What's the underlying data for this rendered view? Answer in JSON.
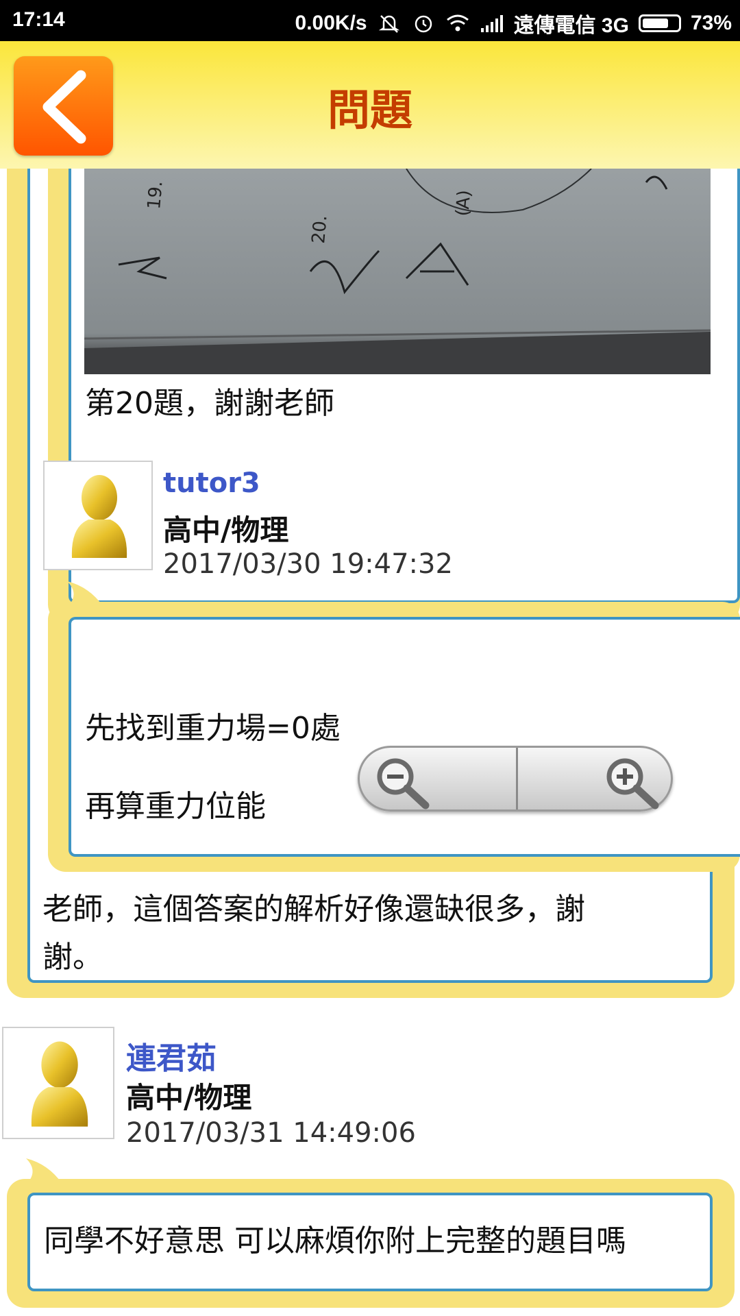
{
  "status_bar": {
    "time": "17:14",
    "speed": "0.00K/s",
    "carrier": "遠傳電信 3G",
    "battery": "73%",
    "battery_level": 0.73,
    "icons": [
      "mute-icon",
      "alarm-icon",
      "wifi-icon",
      "signal-icon",
      "battery-icon"
    ]
  },
  "header": {
    "title": "問題",
    "back_icon": "chevron-left-icon"
  },
  "messages": [
    {
      "caption": "第20題，謝謝老師",
      "photo_description_text": [
        "19.",
        "20.",
        "(A)"
      ]
    },
    {
      "author": "tutor3",
      "subject": "高中/物理",
      "timestamp": "2017/03/30 19:47:32",
      "lines": [
        "先找到重力場=0處",
        "再算重力位能"
      ]
    },
    {
      "text_line1": "老師，這個答案的解析好像還缺很多，謝",
      "text_line2": "謝。"
    },
    {
      "author": "連君茹",
      "subject": "高中/物理",
      "timestamp": "2017/03/31 14:49:06",
      "text": "同學不好意思 可以麻煩你附上完整的題目嗎"
    }
  ],
  "zoom_controls": {
    "zoom_out_icon": "zoom-out-icon",
    "zoom_in_icon": "zoom-in-icon"
  },
  "colors": {
    "header_yellow": "#fbe63b",
    "bubble_yellow": "#f7e27a",
    "box_blue": "#3f95c3",
    "name_blue": "#3d57c8",
    "title_red": "#c43d00",
    "back_orange": "#ff7a0a"
  }
}
